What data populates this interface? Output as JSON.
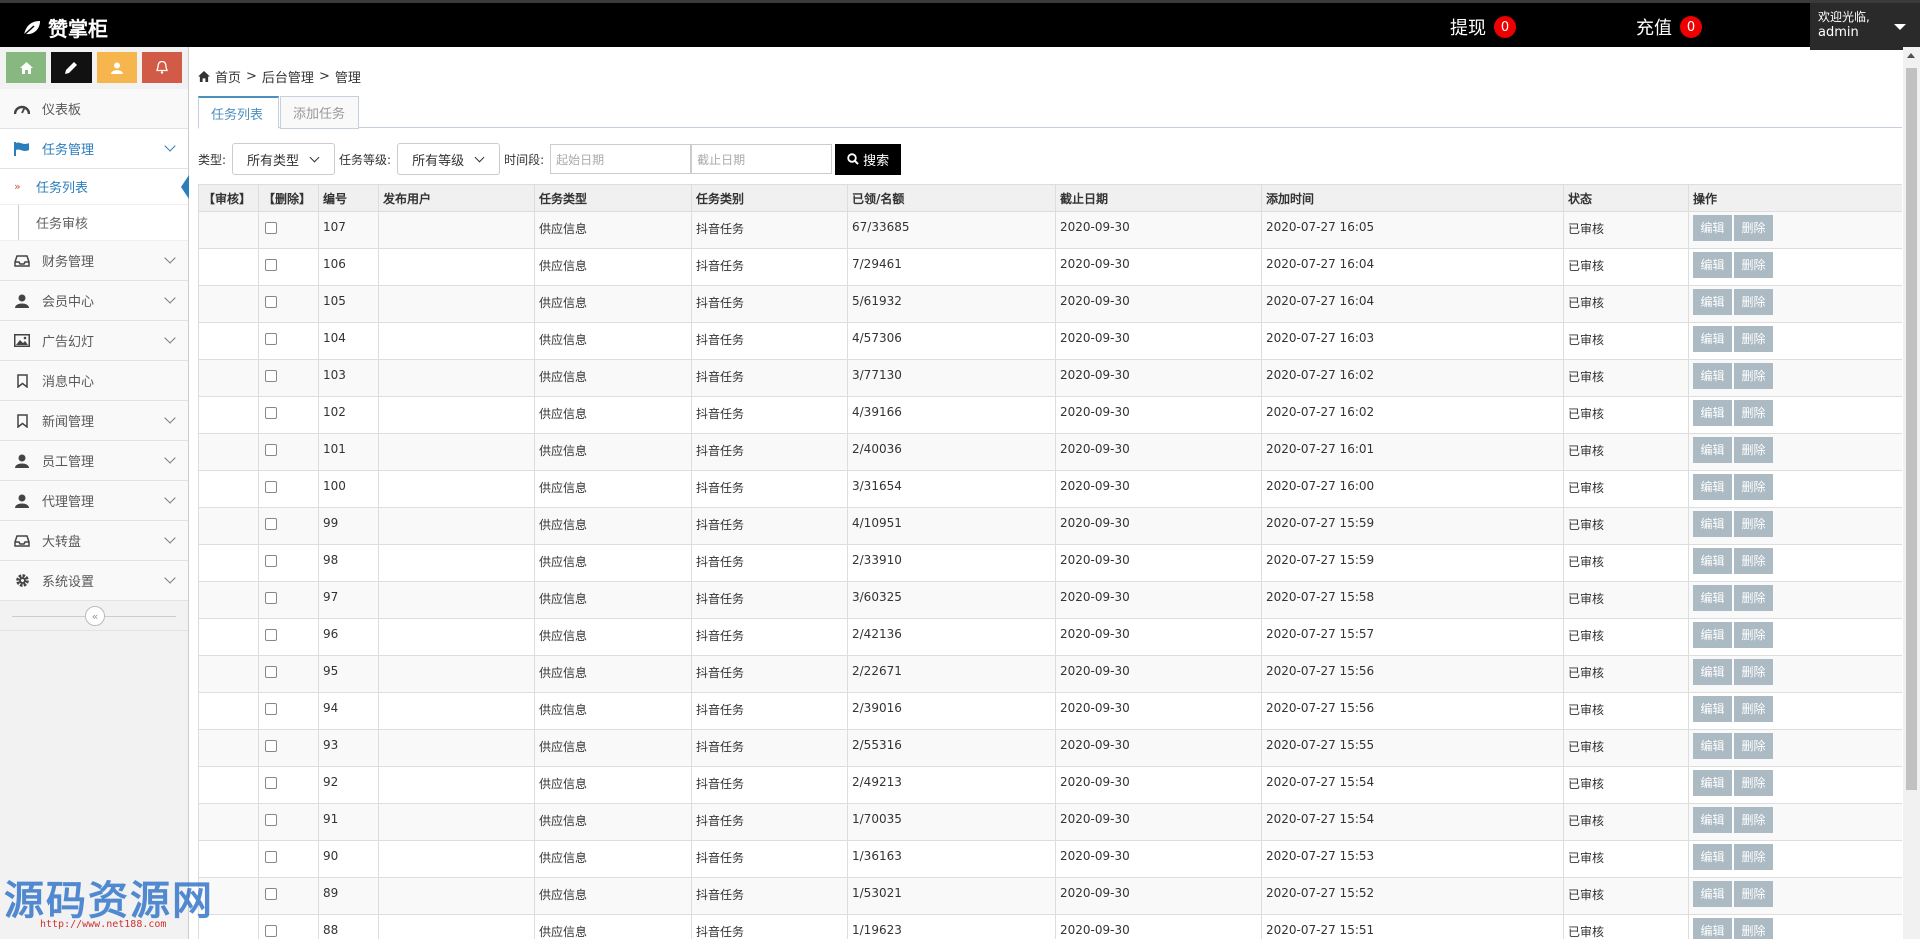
{
  "app": {
    "brand": "赞掌柜",
    "withdraw_label": "提现",
    "withdraw_count": "0",
    "recharge_label": "充值",
    "recharge_count": "0",
    "welcome": "欢迎光临,",
    "username": "admin"
  },
  "sidebar": {
    "items": [
      {
        "label": "仪表板",
        "icon": "dashboard-icon"
      },
      {
        "label": "任务管理",
        "icon": "flag-icon"
      },
      {
        "label": "财务管理",
        "icon": "inbox-icon"
      },
      {
        "label": "会员中心",
        "icon": "user-icon"
      },
      {
        "label": "广告幻灯",
        "icon": "picture-icon"
      },
      {
        "label": "消息中心",
        "icon": "bookmark-icon"
      },
      {
        "label": "新闻管理",
        "icon": "bookmark-icon"
      },
      {
        "label": "员工管理",
        "icon": "user-icon"
      },
      {
        "label": "代理管理",
        "icon": "user-icon"
      },
      {
        "label": "大转盘",
        "icon": "inbox-icon"
      },
      {
        "label": "系统设置",
        "icon": "gear-icon"
      }
    ],
    "sub_items": [
      {
        "label": "任务列表"
      },
      {
        "label": "任务审核"
      }
    ]
  },
  "breadcrumb": {
    "home": "首页",
    "sep": ">",
    "level2": "后台管理",
    "level3": "管理"
  },
  "tabs": {
    "list": "任务列表",
    "add": "添加任务"
  },
  "filters": {
    "type_label": "类型:",
    "type_value": "所有类型",
    "level_label": "任务等级:",
    "level_value": "所有等级",
    "period_label": "时间段:",
    "start_placeholder": "起始日期",
    "end_placeholder": "截止日期",
    "search_label": "搜索"
  },
  "table": {
    "headers": [
      "【审核】",
      "【删除】",
      "编号",
      "发布用户",
      "任务类型",
      "任务类别",
      "已领/名额",
      "截止日期",
      "添加时间",
      "状态",
      "操作"
    ],
    "edit_label": "编辑",
    "delete_label": "删除",
    "rows": [
      {
        "id": "107",
        "type": "供应信息",
        "category": "抖音任务",
        "quota": "67/33685",
        "deadline": "2020-09-30",
        "added": "2020-07-27 16:05",
        "status": "已审核"
      },
      {
        "id": "106",
        "type": "供应信息",
        "category": "抖音任务",
        "quota": "7/29461",
        "deadline": "2020-09-30",
        "added": "2020-07-27 16:04",
        "status": "已审核"
      },
      {
        "id": "105",
        "type": "供应信息",
        "category": "抖音任务",
        "quota": "5/61932",
        "deadline": "2020-09-30",
        "added": "2020-07-27 16:04",
        "status": "已审核"
      },
      {
        "id": "104",
        "type": "供应信息",
        "category": "抖音任务",
        "quota": "4/57306",
        "deadline": "2020-09-30",
        "added": "2020-07-27 16:03",
        "status": "已审核"
      },
      {
        "id": "103",
        "type": "供应信息",
        "category": "抖音任务",
        "quota": "3/77130",
        "deadline": "2020-09-30",
        "added": "2020-07-27 16:02",
        "status": "已审核"
      },
      {
        "id": "102",
        "type": "供应信息",
        "category": "抖音任务",
        "quota": "4/39166",
        "deadline": "2020-09-30",
        "added": "2020-07-27 16:02",
        "status": "已审核"
      },
      {
        "id": "101",
        "type": "供应信息",
        "category": "抖音任务",
        "quota": "2/40036",
        "deadline": "2020-09-30",
        "added": "2020-07-27 16:01",
        "status": "已审核"
      },
      {
        "id": "100",
        "type": "供应信息",
        "category": "抖音任务",
        "quota": "3/31654",
        "deadline": "2020-09-30",
        "added": "2020-07-27 16:00",
        "status": "已审核"
      },
      {
        "id": "99",
        "type": "供应信息",
        "category": "抖音任务",
        "quota": "4/10951",
        "deadline": "2020-09-30",
        "added": "2020-07-27 15:59",
        "status": "已审核"
      },
      {
        "id": "98",
        "type": "供应信息",
        "category": "抖音任务",
        "quota": "2/33910",
        "deadline": "2020-09-30",
        "added": "2020-07-27 15:59",
        "status": "已审核"
      },
      {
        "id": "97",
        "type": "供应信息",
        "category": "抖音任务",
        "quota": "3/60325",
        "deadline": "2020-09-30",
        "added": "2020-07-27 15:58",
        "status": "已审核"
      },
      {
        "id": "96",
        "type": "供应信息",
        "category": "抖音任务",
        "quota": "2/42136",
        "deadline": "2020-09-30",
        "added": "2020-07-27 15:57",
        "status": "已审核"
      },
      {
        "id": "95",
        "type": "供应信息",
        "category": "抖音任务",
        "quota": "2/22671",
        "deadline": "2020-09-30",
        "added": "2020-07-27 15:56",
        "status": "已审核"
      },
      {
        "id": "94",
        "type": "供应信息",
        "category": "抖音任务",
        "quota": "2/39016",
        "deadline": "2020-09-30",
        "added": "2020-07-27 15:56",
        "status": "已审核"
      },
      {
        "id": "93",
        "type": "供应信息",
        "category": "抖音任务",
        "quota": "2/55316",
        "deadline": "2020-09-30",
        "added": "2020-07-27 15:55",
        "status": "已审核"
      },
      {
        "id": "92",
        "type": "供应信息",
        "category": "抖音任务",
        "quota": "2/49213",
        "deadline": "2020-09-30",
        "added": "2020-07-27 15:54",
        "status": "已审核"
      },
      {
        "id": "91",
        "type": "供应信息",
        "category": "抖音任务",
        "quota": "1/70035",
        "deadline": "2020-09-30",
        "added": "2020-07-27 15:54",
        "status": "已审核"
      },
      {
        "id": "90",
        "type": "供应信息",
        "category": "抖音任务",
        "quota": "1/36163",
        "deadline": "2020-09-30",
        "added": "2020-07-27 15:53",
        "status": "已审核"
      },
      {
        "id": "89",
        "type": "供应信息",
        "category": "抖音任务",
        "quota": "1/53021",
        "deadline": "2020-09-30",
        "added": "2020-07-27 15:52",
        "status": "已审核"
      },
      {
        "id": "88",
        "type": "供应信息",
        "category": "抖音任务",
        "quota": "1/19623",
        "deadline": "2020-09-30",
        "added": "2020-07-27 15:51",
        "status": "已审核"
      }
    ]
  },
  "watermark": {
    "text": "源码资源网",
    "url": "http://www.net188.com"
  },
  "colors": {
    "topbar": "#000000",
    "accent": "#2b7dbc",
    "badge": "#ee0000",
    "op_button": "#abbac3"
  }
}
